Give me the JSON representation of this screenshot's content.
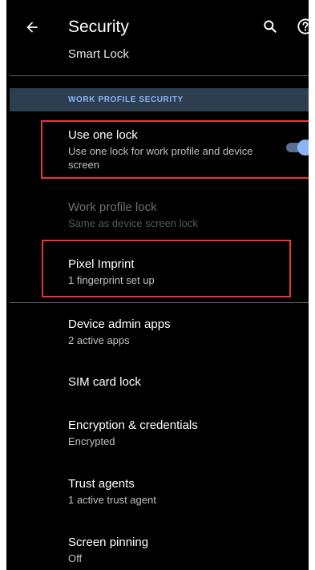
{
  "appbar": {
    "title": "Security",
    "back_icon": "arrow-left-icon",
    "search_icon": "search-icon",
    "help_icon": "help-circle-icon"
  },
  "partial_item": {
    "title": "Smart Lock"
  },
  "section": {
    "header": "WORK PROFILE SECURITY"
  },
  "items": [
    {
      "title": "Use one lock",
      "subtitle": "Use one lock for work profile and device screen",
      "toggle_on": true
    },
    {
      "title": "Work profile lock",
      "subtitle": "Same as device screen lock",
      "disabled": true
    },
    {
      "title": "Pixel Imprint",
      "subtitle": "1 fingerprint set up"
    },
    {
      "title": "Device admin apps",
      "subtitle": "2 active apps"
    },
    {
      "title": "SIM card lock",
      "subtitle": ""
    },
    {
      "title": "Encryption & credentials",
      "subtitle": "Encrypted"
    },
    {
      "title": "Trust agents",
      "subtitle": "1 active trust agent"
    },
    {
      "title": "Screen pinning",
      "subtitle": "Off"
    }
  ],
  "colors": {
    "background": "#000000",
    "accent": "#8ab4f8",
    "section_bg": "#2c3e50",
    "highlight": "#e53935"
  }
}
